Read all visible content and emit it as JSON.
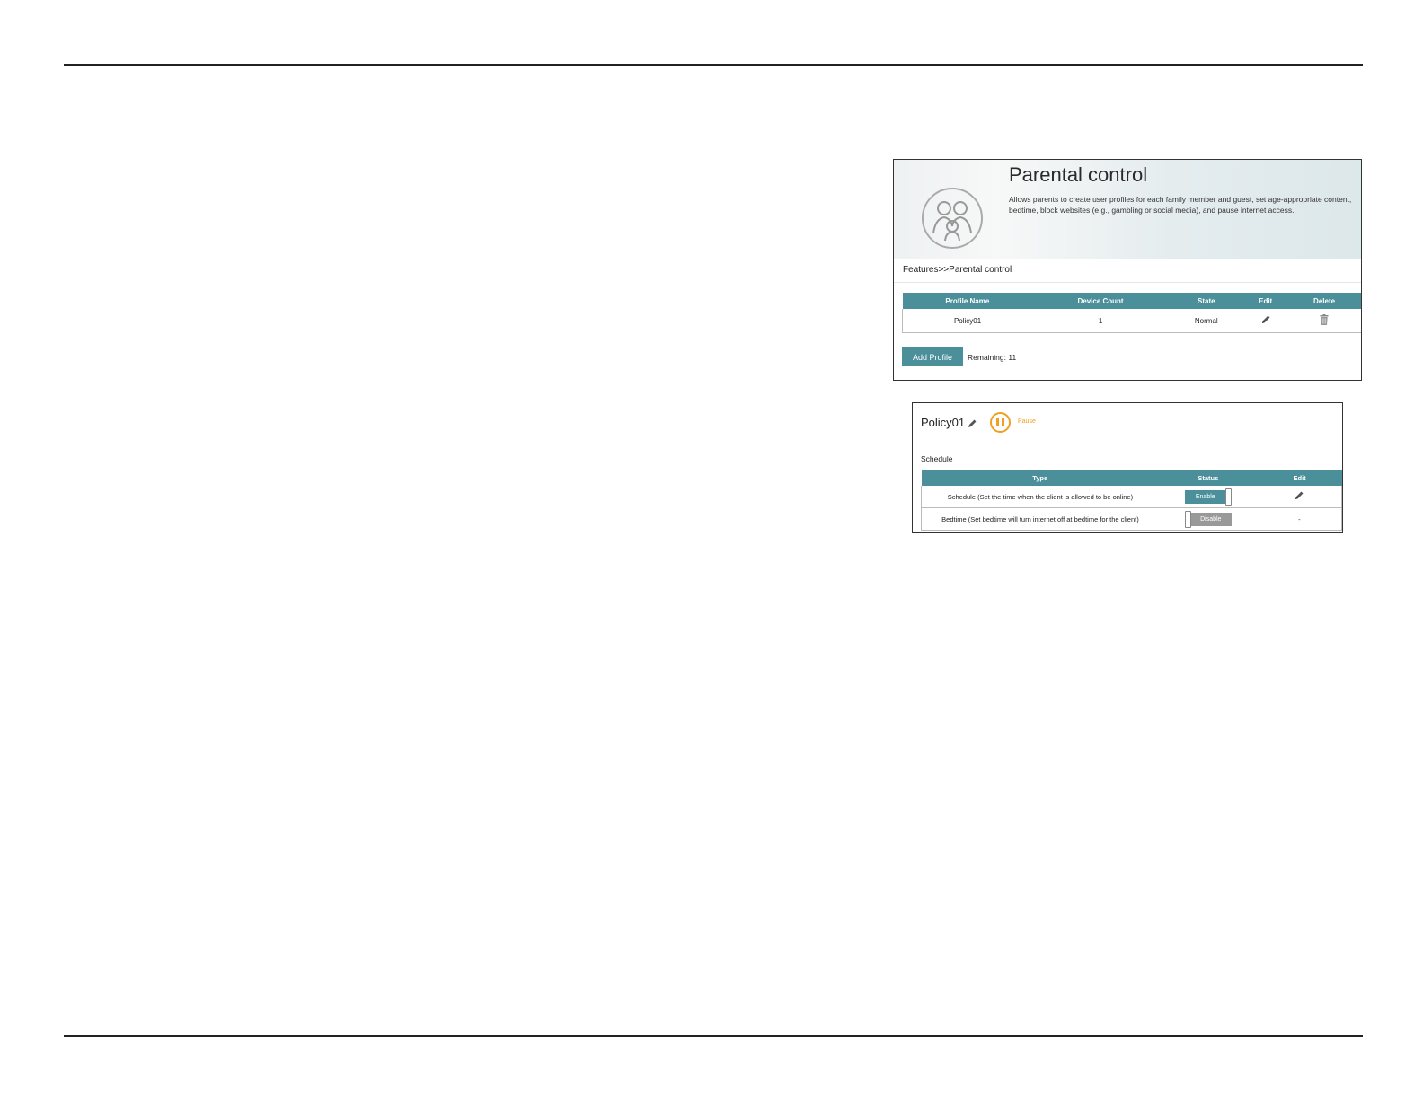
{
  "parental": {
    "title": "Parental control",
    "description": "Allows parents to create user profiles for each family member and guest, set age-appropriate content, bedtime, block websites (e.g., gambling or social media), and pause internet access.",
    "breadcrumb": "Features>>Parental control",
    "columns": [
      "Profile Name",
      "Device Count",
      "State",
      "Edit",
      "Delete"
    ],
    "rows": [
      {
        "profile_name": "Policy01",
        "device_count": "1",
        "state": "Normal",
        "edit_icon": "pencil-icon",
        "delete_icon": "trash-icon"
      }
    ],
    "add_button": "Add Profile",
    "remaining": "Remaining: 11"
  },
  "policy": {
    "name": "Policy01",
    "pause_label": "Pause",
    "pause_color": "#f0a020",
    "section": "Schedule",
    "columns": [
      "Type",
      "Status",
      "Edit"
    ],
    "rows": [
      {
        "type": "Schedule (Set the time when the client is allowed to be online)",
        "status": "Enable",
        "enabled": true,
        "edit": "pencil-icon"
      },
      {
        "type": "Bedtime (Set bedtime will turn internet off at bedtime for the client)",
        "status": "Disable",
        "enabled": false,
        "edit": "-"
      }
    ]
  },
  "colors": {
    "accent": "#4b8f9a",
    "disabled": "#999999",
    "pause": "#f0a020"
  }
}
